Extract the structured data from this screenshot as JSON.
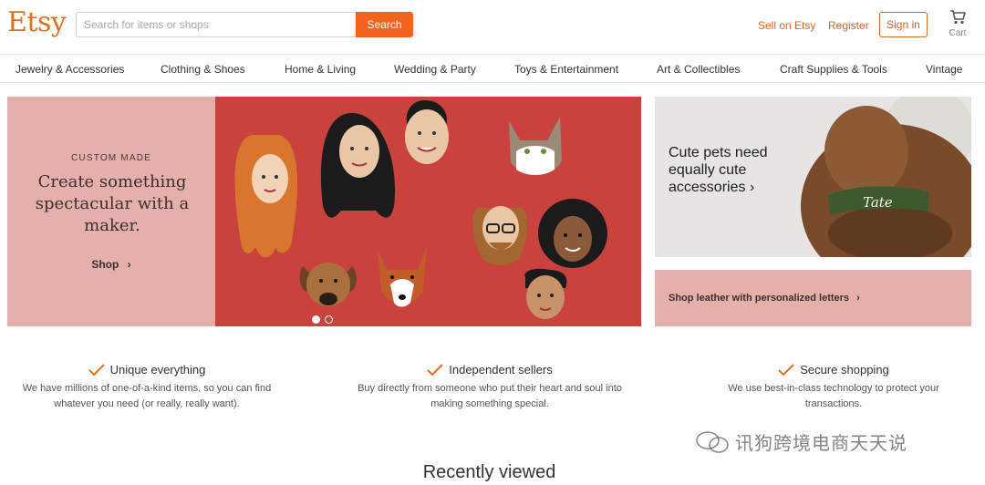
{
  "header": {
    "logo": "Etsy",
    "search_placeholder": "Search for items or shops",
    "search_button": "Search",
    "sell": "Sell on Etsy",
    "register": "Register",
    "sign_in": "Sign in",
    "cart": "Cart",
    "brand_color": "#F1641E"
  },
  "categories": [
    "Jewelry & Accessories",
    "Clothing & Shoes",
    "Home & Living",
    "Wedding & Party",
    "Toys & Entertainment",
    "Art & Collectibles",
    "Craft Supplies & Tools",
    "Vintage"
  ],
  "hero": {
    "kicker": "CUSTOM MADE",
    "title": "Create something spectacular with a maker.",
    "shop_link": "Shop",
    "slide_count": 2,
    "active_slide": 1
  },
  "pets_panel": {
    "text": "Cute pets need equally cute accessories",
    "collar_name": "Tate"
  },
  "leather_panel": {
    "text": "Shop leather with personalized letters"
  },
  "value_props": [
    {
      "title": "Unique everything",
      "body": "We have millions of one-of-a-kind items, so you can find whatever you need (or really, really want)."
    },
    {
      "title": "Independent sellers",
      "body": "Buy directly from someone who put their heart and soul into making something special."
    },
    {
      "title": "Secure shopping",
      "body": "We use best-in-class technology to protect your transactions."
    }
  ],
  "recently_viewed": "Recently viewed",
  "watermark": "讯狗跨境电商天天说"
}
